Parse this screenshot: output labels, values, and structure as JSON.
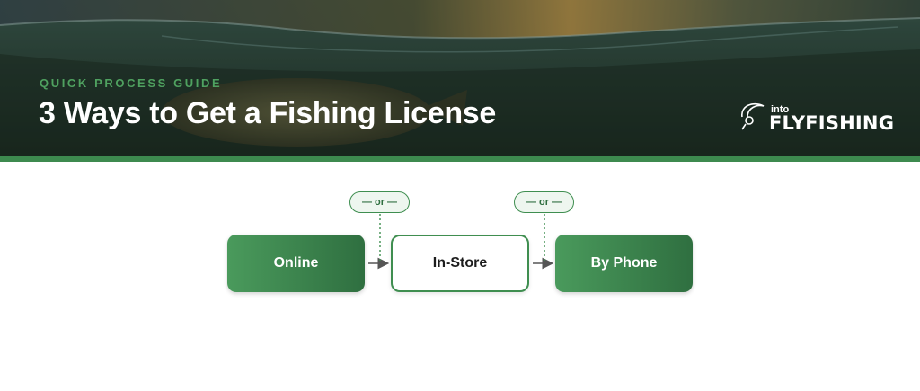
{
  "header": {
    "eyebrow": "QUICK PROCESS GUIDE",
    "title": "3 Ways to Get a Fishing License"
  },
  "logo": {
    "small_text": "into",
    "main_text": "FLYFISHING"
  },
  "flow": {
    "steps": [
      {
        "label": "Online",
        "style": "filled"
      },
      {
        "label": "In-Store",
        "style": "outline"
      },
      {
        "label": "By Phone",
        "style": "filled"
      }
    ],
    "separators": [
      {
        "label": "— or —"
      },
      {
        "label": "— or —"
      }
    ]
  },
  "colors": {
    "accent_green": "#3f8e50",
    "dark_green": "#2f6f40",
    "banner_dark": "#1f2d22"
  }
}
